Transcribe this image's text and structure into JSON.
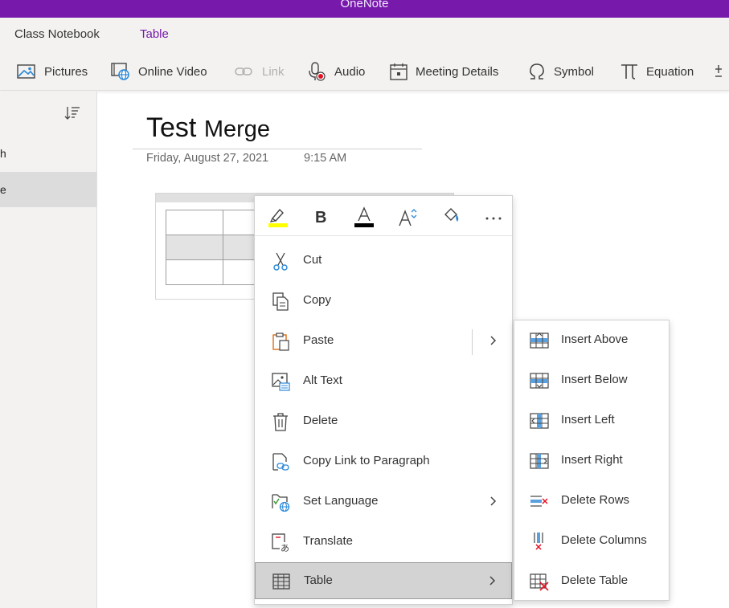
{
  "app": {
    "title": "OneNote"
  },
  "tabs": [
    {
      "label": "Class Notebook"
    },
    {
      "label": "Table",
      "active": true
    }
  ],
  "ribbon": {
    "items": [
      {
        "label": "Pictures",
        "icon": "pictures-icon"
      },
      {
        "label": "Online Video",
        "icon": "online-video-icon"
      },
      {
        "label": "Link",
        "icon": "link-icon",
        "disabled": true
      },
      {
        "label": "Audio",
        "icon": "audio-icon"
      },
      {
        "label": "Meeting Details",
        "icon": "meeting-details-icon"
      },
      {
        "label": "Symbol",
        "icon": "omega-icon"
      },
      {
        "label": "Equation",
        "icon": "pi-icon"
      }
    ]
  },
  "pagelist": {
    "items": [
      {
        "label": "h"
      },
      {
        "label": "e",
        "selected": true
      }
    ]
  },
  "page": {
    "title_part1": "Test",
    "title_part2": "Merge",
    "date": "Friday, August 27, 2021",
    "time": "9:15 AM"
  },
  "minibar": {
    "buttons": [
      "highlight-icon",
      "bold-icon",
      "font-color-icon",
      "font-size-icon",
      "format-painter-icon",
      "more-icon"
    ],
    "highlight_color": "#ffff00",
    "font_color": "#000000"
  },
  "context_menu": {
    "items": [
      {
        "label": "Cut",
        "icon": "scissors-icon"
      },
      {
        "label": "Copy",
        "icon": "copy-icon"
      },
      {
        "label": "Paste",
        "icon": "paste-icon",
        "submenu": true
      },
      {
        "label": "Alt Text",
        "icon": "alt-text-icon"
      },
      {
        "label": "Delete",
        "icon": "trash-icon"
      },
      {
        "label": "Copy Link to Paragraph",
        "icon": "link-paragraph-icon"
      },
      {
        "label": "Set Language",
        "icon": "set-language-icon",
        "submenu": true
      },
      {
        "label": "Translate",
        "icon": "translate-icon"
      },
      {
        "label": "Table",
        "icon": "table-icon",
        "submenu": true,
        "highlighted": true
      }
    ]
  },
  "table_submenu": {
    "items": [
      {
        "label": "Insert Above",
        "icon": "insert-above-icon"
      },
      {
        "label": "Insert Below",
        "icon": "insert-below-icon"
      },
      {
        "label": "Insert Left",
        "icon": "insert-left-icon"
      },
      {
        "label": "Insert Right",
        "icon": "insert-right-icon"
      },
      {
        "label": "Delete Rows",
        "icon": "delete-rows-icon"
      },
      {
        "label": "Delete Columns",
        "icon": "delete-columns-icon"
      },
      {
        "label": "Delete Table",
        "icon": "delete-table-icon"
      }
    ]
  },
  "colors": {
    "accent": "#7719aa",
    "icon_blue": "#2b88d8",
    "delete_red": "#e81123"
  }
}
